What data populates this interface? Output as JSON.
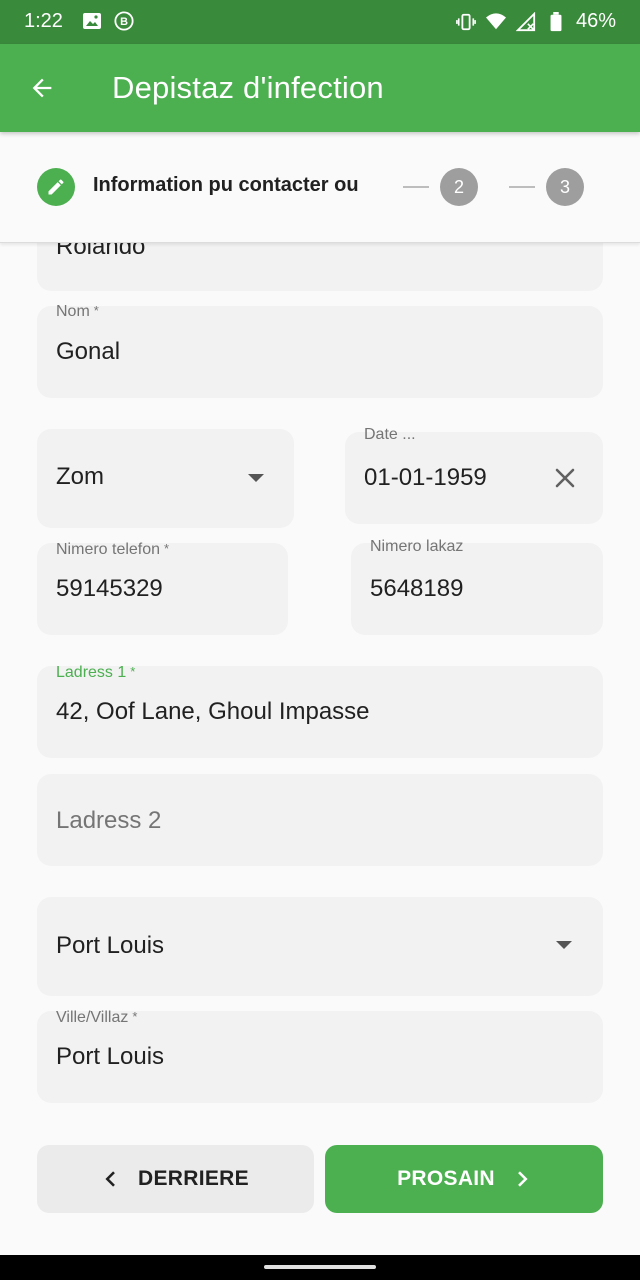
{
  "status_bar": {
    "time": "1:22",
    "battery": "46%",
    "icons": [
      "image-icon",
      "b-badge-icon",
      "vibrate-icon",
      "wifi-icon",
      "signal-icon",
      "battery-icon"
    ]
  },
  "app_bar": {
    "title": "Depistaz d'infection",
    "back_icon": "arrow-back-icon"
  },
  "stepper": {
    "current_step_label": "Information pu contacter ou",
    "step2": "2",
    "step3": "3"
  },
  "form": {
    "first_name_value": "Rolando",
    "last_name_label": "Nom",
    "last_name_value": "Gonal",
    "gender_value": "Zom",
    "dob_label": "Date ...",
    "dob_value": "01-01-1959",
    "phone_label": "Nimero telefon",
    "phone_value": "59145329",
    "home_phone_label": "Nimero lakaz",
    "home_phone_value": "5648189",
    "address1_label": "Ladress 1",
    "address1_value": "42, Oof Lane, Ghoul Impasse",
    "address2_placeholder": "Ladress 2",
    "district_value": "Port Louis",
    "city_label": "Ville/Villaz",
    "city_value": "Port Louis",
    "required_mark": "*"
  },
  "buttons": {
    "back_label": "DERRIERE",
    "next_label": "PROSAIN"
  },
  "colors": {
    "primary": "#4caf50",
    "status_bar": "#3a8a3c",
    "field_bg": "#f2f2f2"
  }
}
